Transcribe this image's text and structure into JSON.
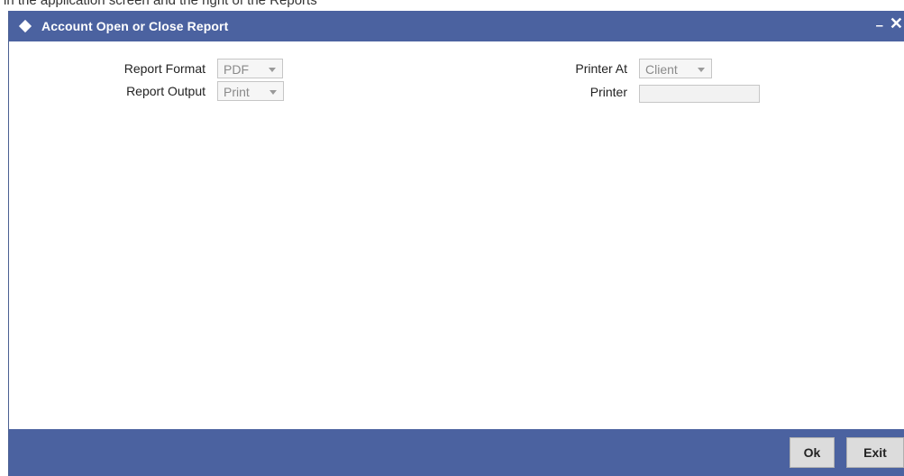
{
  "background_caption": "in the application screen and the right of the Reports",
  "window": {
    "title": "Account Open or Close Report",
    "minimize_glyph": "–",
    "close_glyph": "✕"
  },
  "form": {
    "report_format": {
      "label": "Report Format",
      "value": "PDF"
    },
    "report_output": {
      "label": "Report Output",
      "value": "Print"
    },
    "printer_at": {
      "label": "Printer At",
      "value": "Client"
    },
    "printer": {
      "label": "Printer",
      "value": ""
    }
  },
  "footer": {
    "ok_label": "Ok",
    "exit_label": "Exit"
  },
  "colors": {
    "titlebar": "#4b62a0",
    "footer": "#4b62a0"
  },
  "icons": [
    "diamond-icon",
    "minimize-icon",
    "close-icon",
    "dropdown-arrow-icon"
  ]
}
